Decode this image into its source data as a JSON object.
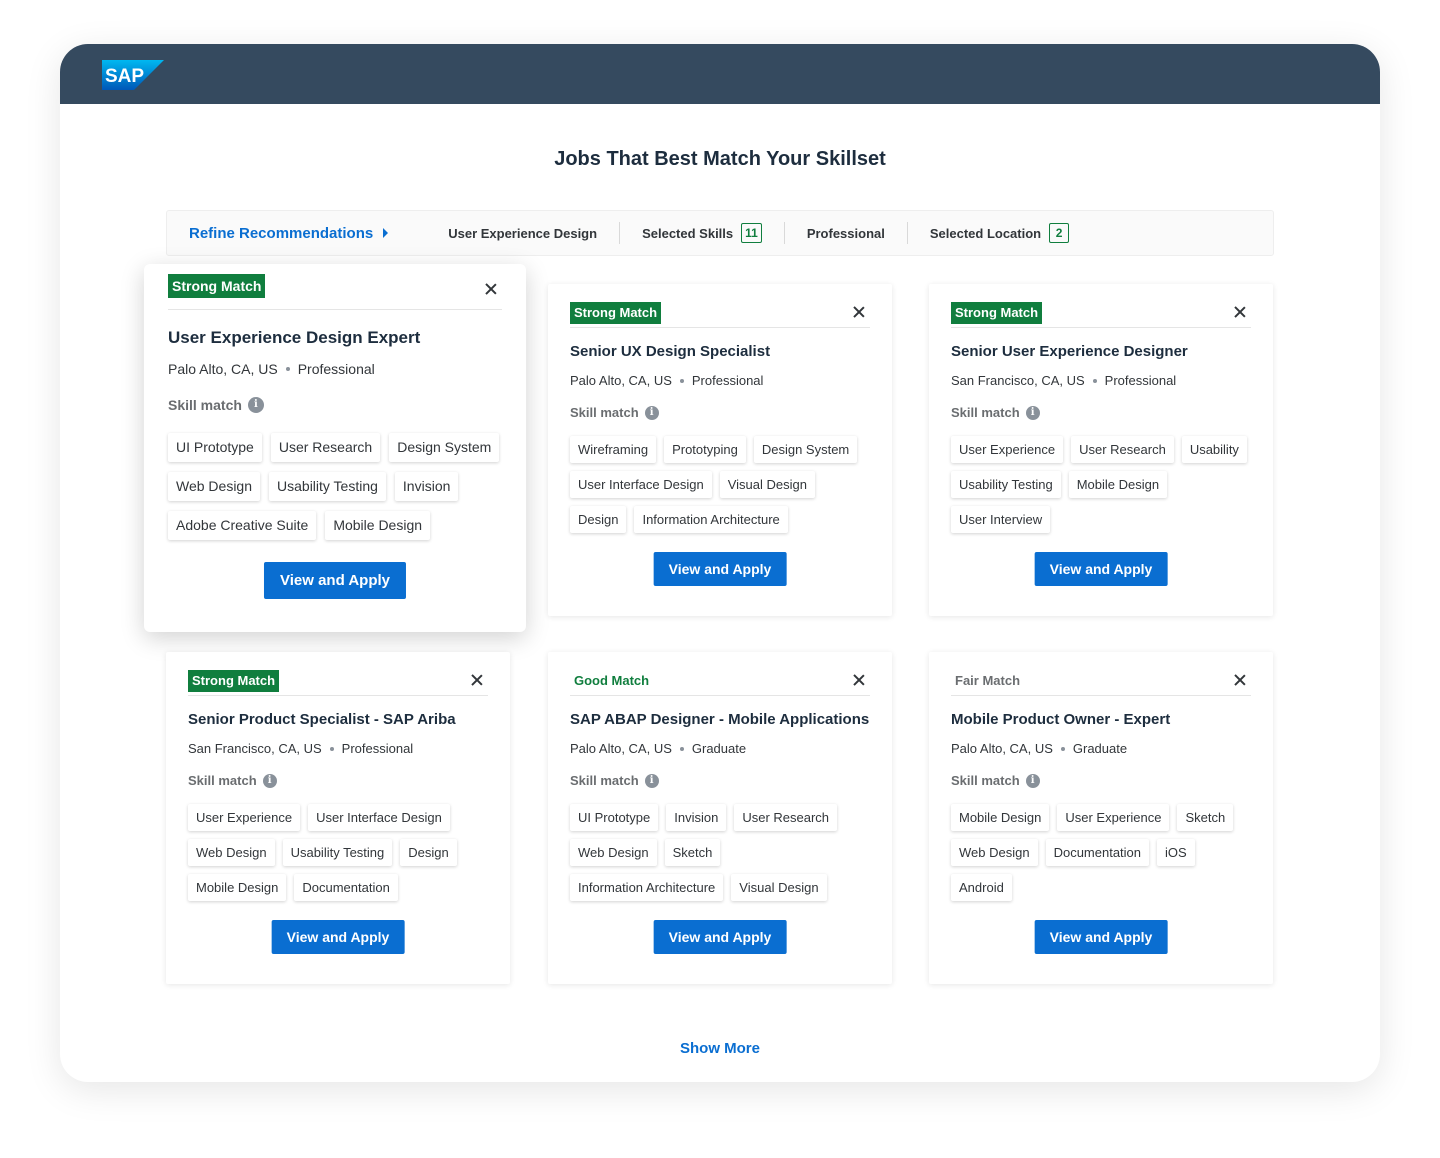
{
  "app": {
    "logo_text": "SAP",
    "brand_color": "#0a6ed1",
    "header_color": "#354a5f"
  },
  "page": {
    "title": "Jobs That Best Match Your Skillset"
  },
  "filters": {
    "refine_label": "Refine Recommendations",
    "role": "User Experience Design",
    "skills_label": "Selected Skills",
    "skills_count": "11",
    "level": "Professional",
    "location_label": "Selected Location",
    "location_count": "2"
  },
  "common": {
    "skill_match_label": "Skill match",
    "apply_label": "View and Apply",
    "info_icon": "i"
  },
  "jobs": [
    {
      "match": "Strong Match",
      "title": "User Experience Design Expert",
      "location": "Palo Alto, CA, US",
      "level": "Professional",
      "skills": [
        "UI Prototype",
        "User Research",
        "Design System",
        "Web Design",
        "Usability Testing",
        "Invision",
        "Adobe Creative Suite",
        "Mobile Design"
      ]
    },
    {
      "match": "Strong Match",
      "title": "Senior UX Design Specialist",
      "location": "Palo Alto, CA, US",
      "level": "Professional",
      "skills": [
        "Wireframing",
        "Prototyping",
        "Design System",
        "User Interface Design",
        "Visual Design",
        "Design",
        "Information Architecture"
      ]
    },
    {
      "match": "Strong Match",
      "title": "Senior User Experience Designer",
      "location": "San Francisco, CA, US",
      "level": "Professional",
      "skills": [
        "User Experience",
        "User Research",
        "Usability",
        "Usability Testing",
        "Mobile Design",
        "User Interview"
      ]
    },
    {
      "match": "Strong Match",
      "title": "Senior Product Specialist - SAP Ariba",
      "location": "San Francisco, CA, US",
      "level": "Professional",
      "skills": [
        "User Experience",
        "User Interface Design",
        "Web Design",
        "Usability Testing",
        "Design",
        "Mobile Design",
        "Documentation"
      ]
    },
    {
      "match": "Good Match",
      "title": "SAP ABAP Designer - Mobile Applications",
      "location": "Palo Alto, CA, US",
      "level": "Graduate",
      "skills": [
        "UI Prototype",
        "Invision",
        "User Research",
        "Web Design",
        "Sketch",
        "Information Architecture",
        "Visual Design"
      ]
    },
    {
      "match": "Fair Match",
      "title": "Mobile Product Owner - Expert",
      "location": "Palo Alto, CA, US",
      "level": "Graduate",
      "skills": [
        "Mobile Design",
        "User Experience",
        "Sketch",
        "Web Design",
        "Documentation",
        "iOS",
        "Android"
      ]
    }
  ],
  "show_more_label": "Show More"
}
